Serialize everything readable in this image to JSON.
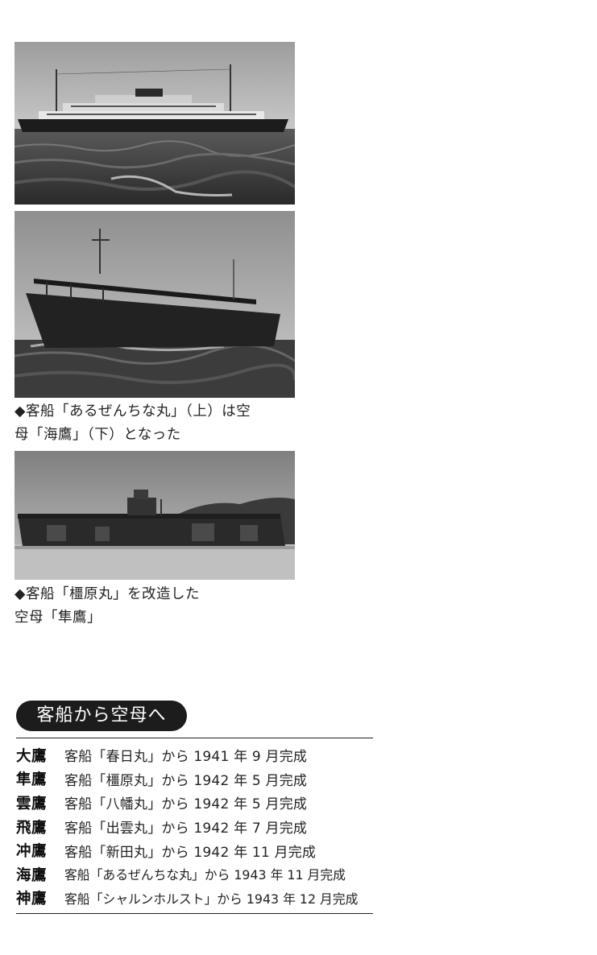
{
  "photos": [
    {
      "name": "passenger-ship-argentina-maru-photo"
    },
    {
      "name": "carrier-kaiyo-photo"
    },
    {
      "name": "carrier-junyo-photo"
    }
  ],
  "captions": [
    {
      "lines": [
        "◆客船「あるぜんちな丸」（上）は空",
        "母「海鷹」（下）となった"
      ]
    },
    {
      "lines": [
        "◆客船「橿原丸」を改造した",
        "空母「隼鷹」"
      ]
    }
  ],
  "section": {
    "title": "客船から空母へ",
    "rows": [
      {
        "name": "大鷹",
        "desc": "客船「春日丸」から 1941 年 9 月完成"
      },
      {
        "name": "隼鷹",
        "desc": "客船「橿原丸」から 1942 年 5 月完成"
      },
      {
        "name": "雲鷹",
        "desc": "客船「八幡丸」から 1942 年 5 月完成"
      },
      {
        "name": "飛鷹",
        "desc": "客船「出雲丸」から 1942 年 7 月完成"
      },
      {
        "name": "冲鷹",
        "desc": "客船「新田丸」から 1942 年 11 月完成"
      },
      {
        "name": "海鷹",
        "desc": "客船「あるぜんちな丸」から 1943 年 11 月完成"
      },
      {
        "name": "神鷹",
        "desc": "客船「シャルンホルスト」から 1943 年 12 月完成"
      }
    ]
  }
}
